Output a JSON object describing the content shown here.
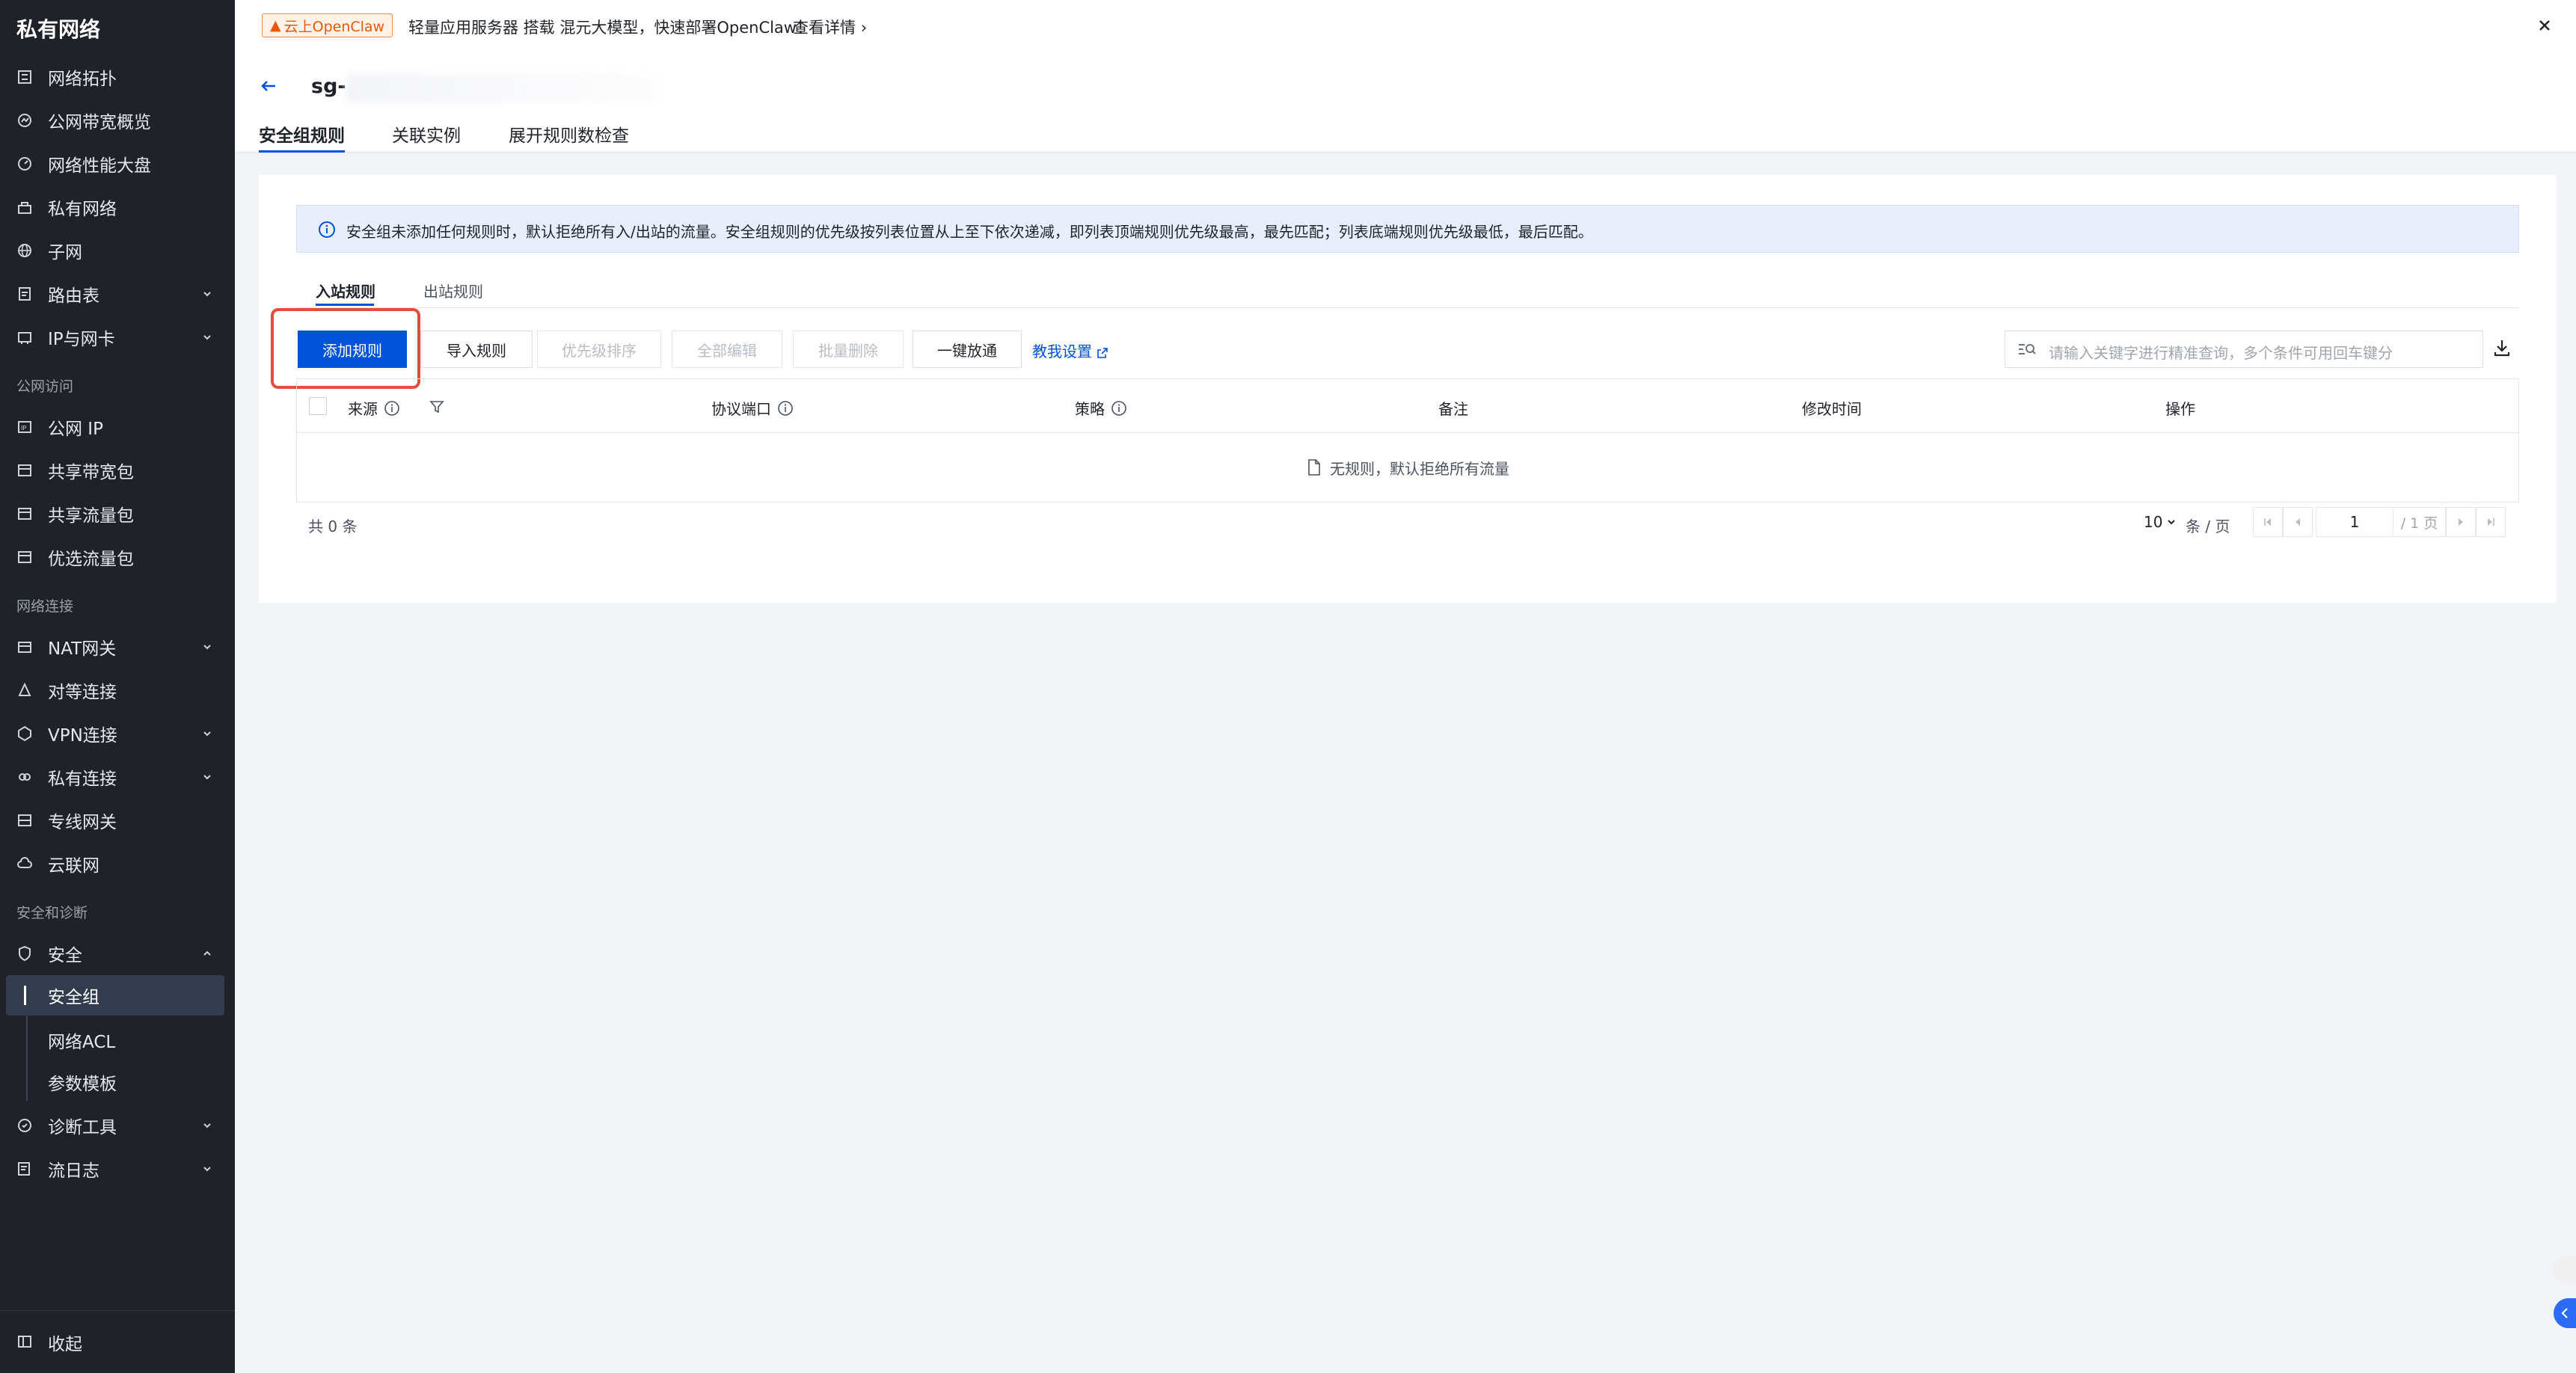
{
  "sidebar": {
    "title": "私有网络",
    "items": [
      {
        "label": "网络拓扑",
        "icon": "topology-icon"
      },
      {
        "label": "公网带宽概览",
        "icon": "bandwidth-icon"
      },
      {
        "label": "网络性能大盘",
        "icon": "dashboard-icon"
      },
      {
        "label": "私有网络",
        "icon": "vpc-icon"
      },
      {
        "label": "子网",
        "icon": "subnet-icon"
      },
      {
        "label": "路由表",
        "icon": "route-table-icon"
      },
      {
        "label": "IP与网卡",
        "icon": "ip-nic-icon"
      }
    ],
    "section_public": "公网访问",
    "public_items": [
      {
        "label": "公网 IP"
      },
      {
        "label": "共享带宽包"
      },
      {
        "label": "共享流量包"
      },
      {
        "label": "优选流量包"
      }
    ],
    "section_conn": "网络连接",
    "conn_items": [
      {
        "label": "NAT网关"
      },
      {
        "label": "对等连接"
      },
      {
        "label": "VPN连接"
      },
      {
        "label": "私有连接"
      },
      {
        "label": "专线网关"
      },
      {
        "label": "云联网"
      }
    ],
    "section_security": "安全和诊断",
    "security": {
      "label": "安全"
    },
    "security_sub": [
      {
        "label": "安全组"
      },
      {
        "label": "网络ACL"
      },
      {
        "label": "参数模板"
      }
    ],
    "diag_items": [
      {
        "label": "诊断工具"
      },
      {
        "label": "流日志"
      }
    ],
    "collapse": "收起"
  },
  "banner": {
    "badge": "云上OpenClaw",
    "text": "轻量应用服务器 搭载 混元大模型，快速部署OpenClaw！",
    "link": "查看详情"
  },
  "header": {
    "title": "sg-",
    "tabs": [
      "安全组规则",
      "关联实例",
      "展开规则数检查"
    ]
  },
  "info": {
    "text": "安全组未添加任何规则时，默认拒绝所有入/出站的流量。安全组规则的优先级按列表位置从上至下依次递减，即列表顶端规则优先级最高，最先匹配；列表底端规则优先级最低，最后匹配。"
  },
  "subtabs": [
    "入站规则",
    "出站规则"
  ],
  "toolbar": {
    "add": "添加规则",
    "import": "导入规则",
    "sort": "优先级排序",
    "edit_all": "全部编辑",
    "batch_delete": "批量删除",
    "allow_all": "一键放通",
    "help_link": "教我设置",
    "search_placeholder": "请输入关键字进行精准查询，多个条件可用回车键分"
  },
  "table": {
    "columns": [
      "来源",
      "协议端口",
      "策略",
      "备注",
      "修改时间",
      "操作"
    ],
    "empty": "无规则，默认拒绝所有流量"
  },
  "pagination": {
    "total": "共 0 条",
    "page_size": "10",
    "unit": "条 / 页",
    "current": "1",
    "pages": "/ 1 页"
  },
  "colors": {
    "primary": "#0052d9",
    "sidebar_bg": "#1f2329",
    "highlight": "#e34d3a"
  }
}
